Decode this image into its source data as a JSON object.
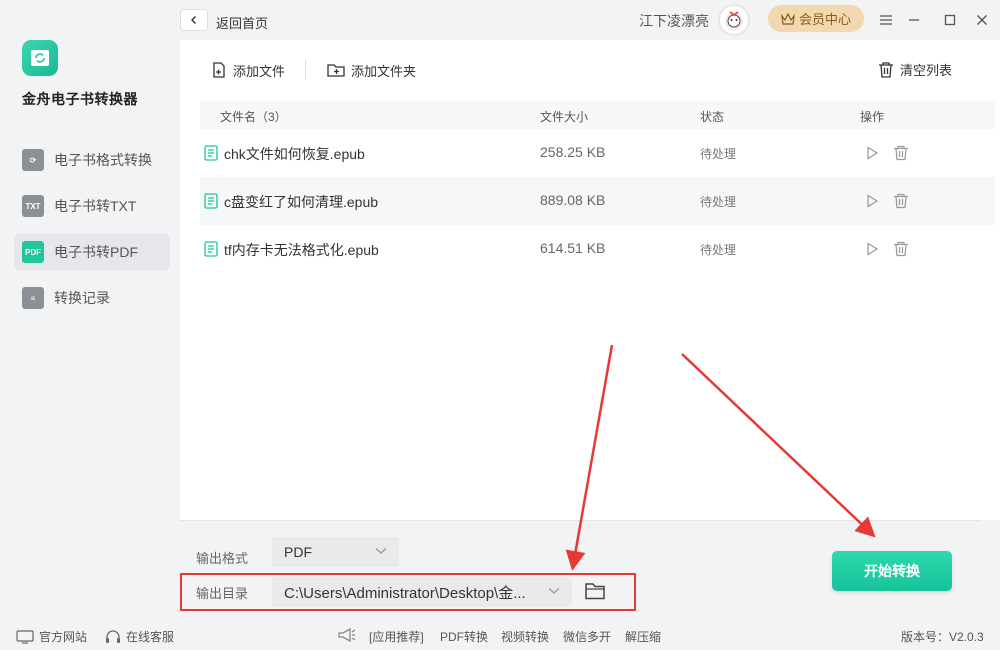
{
  "app": {
    "name": "金舟电子书转换器"
  },
  "titlebar": {
    "back_label": "返回首页",
    "username": "江下凌漂亮",
    "vip_label": "会员中心"
  },
  "sidebar": {
    "items": [
      {
        "label": "电子书格式转换",
        "icon": "convert-icon",
        "badge": ""
      },
      {
        "label": "电子书转TXT",
        "icon": "txt-icon",
        "badge": "TXT"
      },
      {
        "label": "电子书转PDF",
        "icon": "pdf-icon",
        "badge": "PDF",
        "active": true
      },
      {
        "label": "转换记录",
        "icon": "record-icon",
        "badge": ""
      }
    ]
  },
  "toolbar": {
    "add_file": "添加文件",
    "add_folder": "添加文件夹",
    "clear_list": "清空列表"
  },
  "table": {
    "headers": {
      "name": "文件名（3）",
      "size": "文件大小",
      "status": "状态",
      "actions": "操作"
    },
    "rows": [
      {
        "name": "chk文件如何恢复.epub",
        "size": "258.25 KB",
        "status": "待处理"
      },
      {
        "name": "c盘变红了如何清理.epub",
        "size": "889.08 KB",
        "status": "待处理"
      },
      {
        "name": "tf内存卡无法格式化.epub",
        "size": "614.51 KB",
        "status": "待处理"
      }
    ]
  },
  "output": {
    "format_label": "输出格式",
    "format_value": "PDF",
    "dir_label": "输出目录",
    "dir_value": "C:\\Users\\Administrator\\Desktop\\金..."
  },
  "start_button": "开始转换",
  "statusbar": {
    "website": "官方网站",
    "support": "在线客服",
    "links": [
      "[应用推荐]",
      "PDF转换",
      "视频转换",
      "微信多开",
      "解压缩"
    ],
    "version": "版本号：V2.0.3"
  },
  "colors": {
    "accent": "#1fc59b",
    "highlight": "#e53935",
    "vip": "#f3d7ae"
  }
}
